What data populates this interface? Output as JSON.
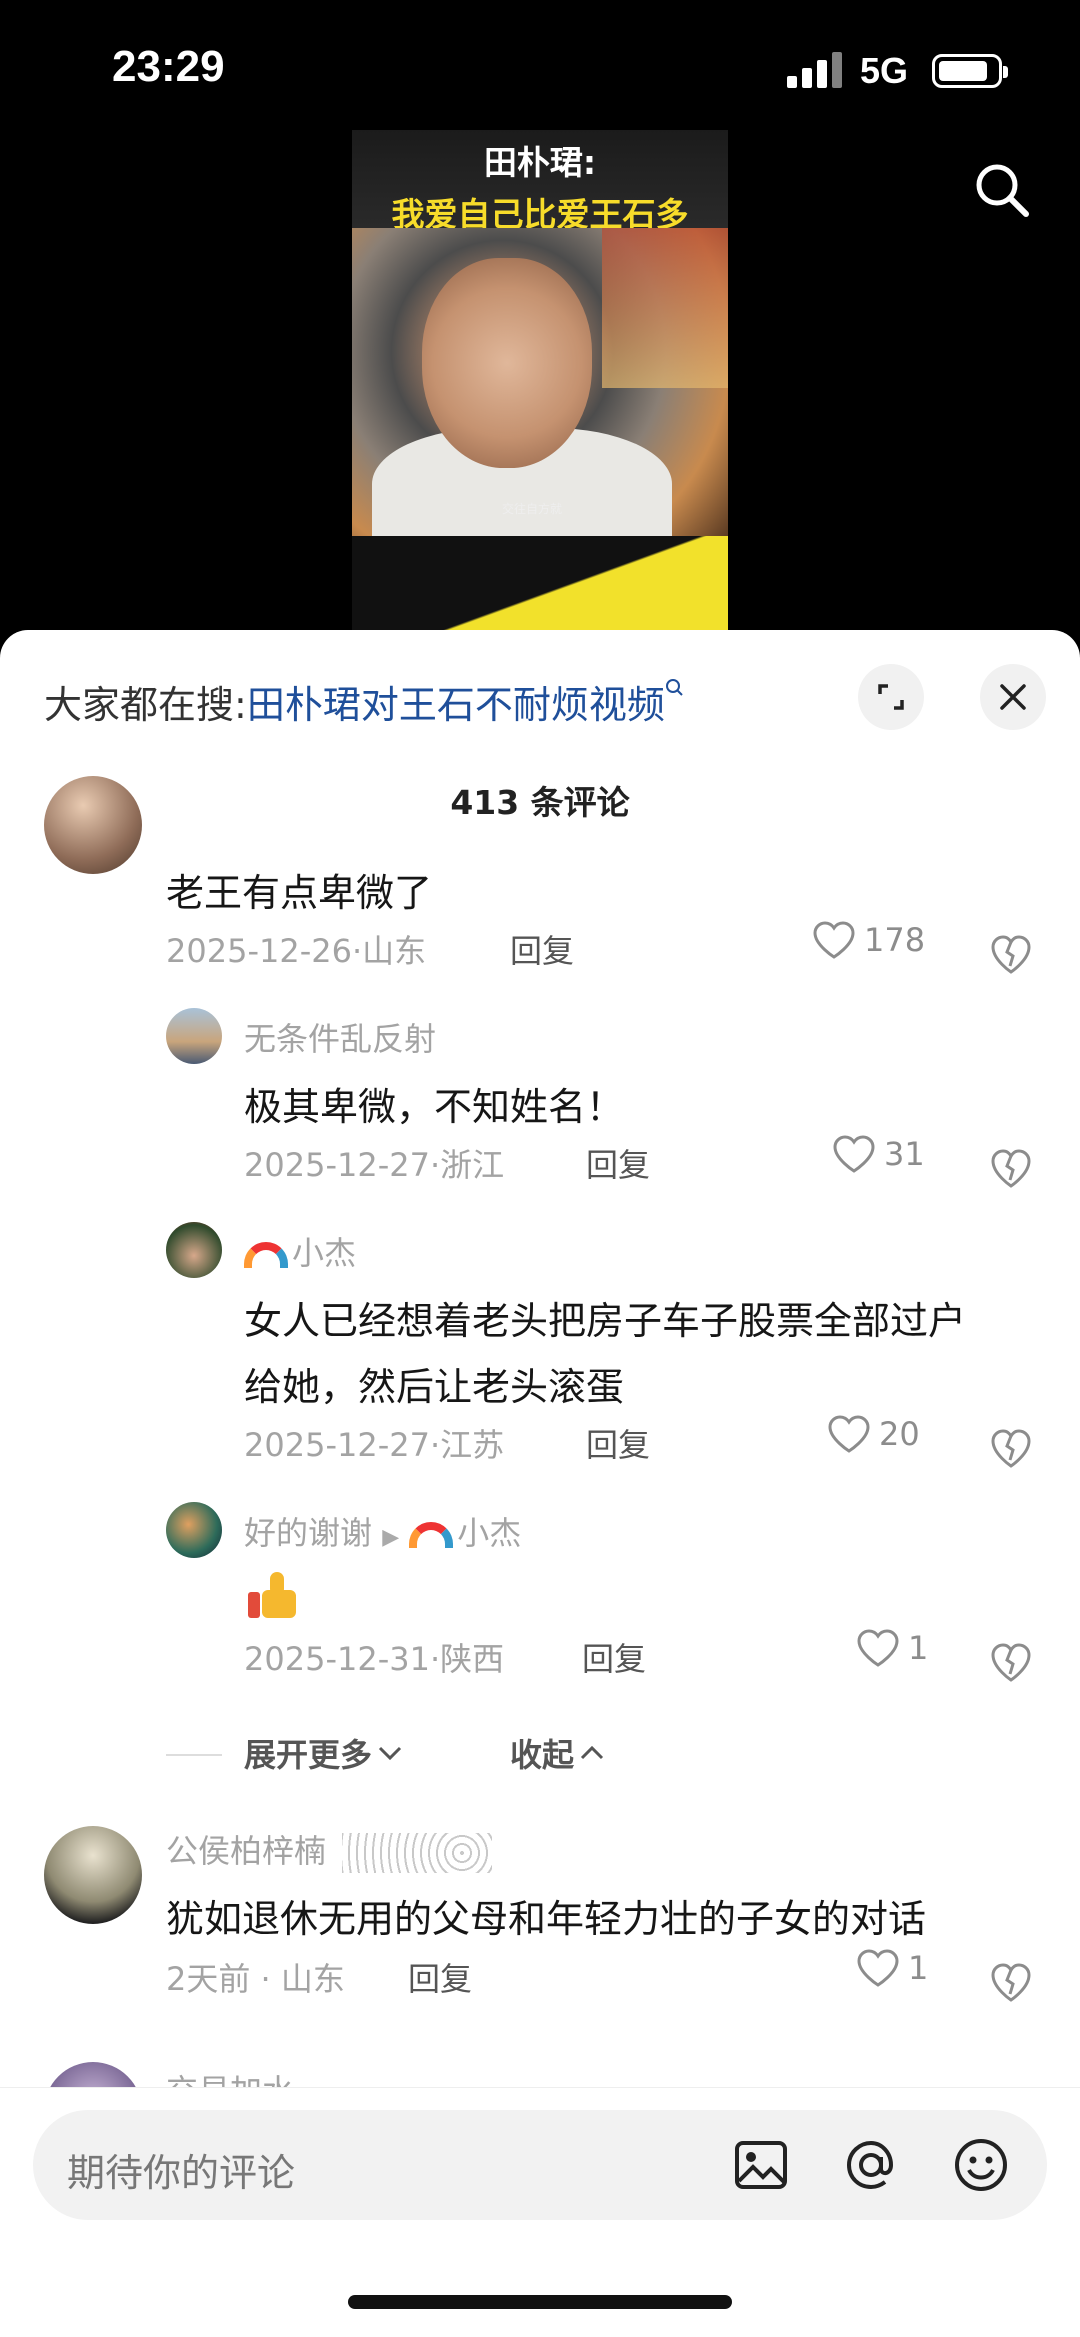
{
  "status": {
    "time": "23:29",
    "network": "5G"
  },
  "video": {
    "caption_line1": "田朴珺:",
    "caption_line2": "我爱自己比爱王石多",
    "subtitle": "交往自方就"
  },
  "hot_search": {
    "prefix": "大家都在搜:",
    "query": "田朴珺对王石不耐烦视频"
  },
  "comments_header": {
    "count_label": "413 条评论"
  },
  "comments": [
    {
      "text": "老王有点卑微了",
      "date": "2025-12-26",
      "location": "山东",
      "reply": "回复",
      "likes": "178"
    },
    {
      "name": "无条件乱反射",
      "text": "极其卑微，不知姓名！",
      "date": "2025-12-27",
      "location": "浙江",
      "reply": "回复",
      "likes": "31"
    },
    {
      "name": "小杰",
      "text_line1": "女人已经想着老头把房子车子股票全部过户",
      "text_line2": "给她，然后让老头滚蛋",
      "date": "2025-12-27",
      "location": "江苏",
      "reply": "回复",
      "likes": "20"
    },
    {
      "name": "好的谢谢",
      "reply_to": "小杰",
      "date": "2025-12-31",
      "location": "陕西",
      "reply": "回复",
      "likes": "1"
    },
    {
      "name": "公侯柏梓楠",
      "text": "犹如退休无用的父母和年轻力壮的子女的对话",
      "date": "2天前",
      "location": "山东",
      "reply": "回复",
      "likes": "1"
    },
    {
      "name": "交易加水"
    }
  ],
  "thread_controls": {
    "expand": "展开更多",
    "collapse": "收起"
  },
  "input": {
    "placeholder": "期待你的评论"
  }
}
